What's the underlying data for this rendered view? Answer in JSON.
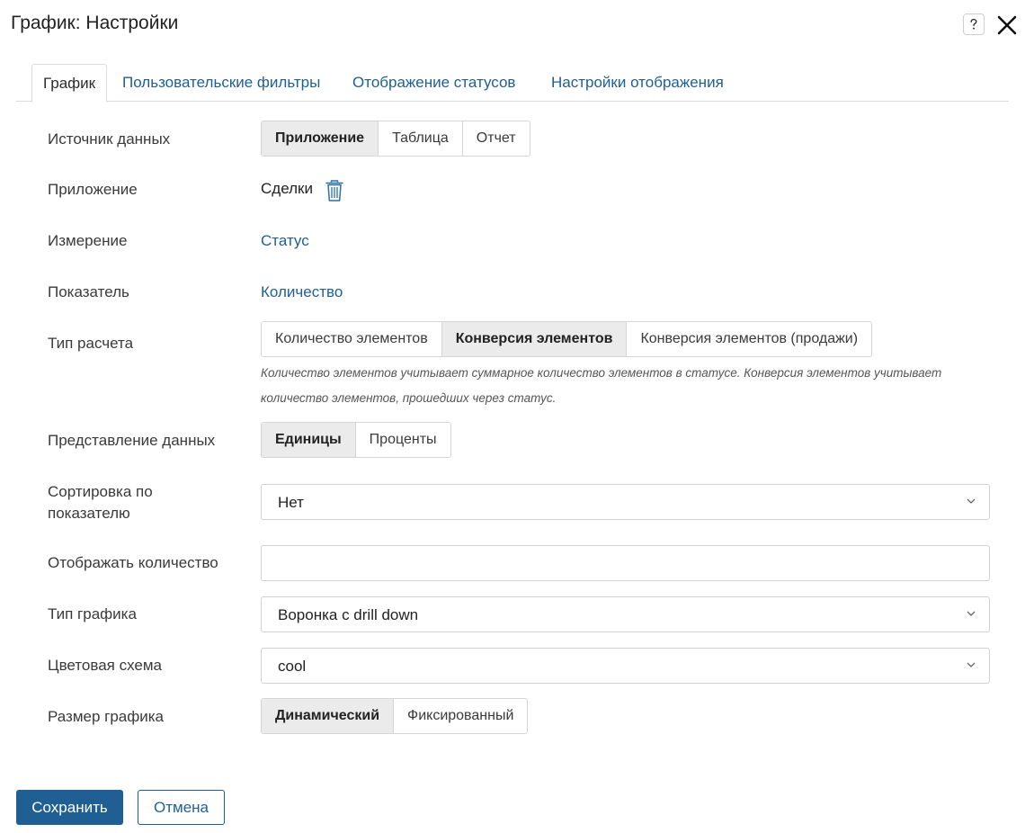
{
  "dialog": {
    "title": "График: Настройки",
    "help_icon": "question-icon",
    "close_icon": "close-icon"
  },
  "tabs": [
    {
      "label": "График",
      "active": true
    },
    {
      "label": "Пользовательские фильтры",
      "active": false
    },
    {
      "label": "Отображение статусов",
      "active": false
    },
    {
      "label": "Настройки отображения",
      "active": false
    }
  ],
  "form": {
    "data_source": {
      "label": "Источник данных",
      "options": [
        "Приложение",
        "Таблица",
        "Отчет"
      ],
      "selected": "Приложение"
    },
    "app": {
      "label": "Приложение",
      "value": "Сделки",
      "delete_icon": "trash-icon"
    },
    "dimension": {
      "label": "Измерение",
      "value": "Статус"
    },
    "metric": {
      "label": "Показатель",
      "value": "Количество"
    },
    "calc_type": {
      "label": "Тип расчета",
      "options": [
        "Количество элементов",
        "Конверсия элементов",
        "Конверсия элементов (продажи)"
      ],
      "selected": "Конверсия элементов",
      "hint": "Количество элементов учитывает суммарное количество элементов в статусе. Конверсия элементов учитывает количество элементов, прошедших через статус."
    },
    "data_view": {
      "label": "Представление данных",
      "options": [
        "Единицы",
        "Проценты"
      ],
      "selected": "Единицы"
    },
    "sort": {
      "label": "Сортировка по показателю",
      "value": "Нет"
    },
    "show_count": {
      "label": "Отображать количество",
      "value": ""
    },
    "chart_type": {
      "label": "Тип графика",
      "value": "Воронка с drill down"
    },
    "color_scheme": {
      "label": "Цветовая схема",
      "value": "cool"
    },
    "chart_size": {
      "label": "Размер графика",
      "options": [
        "Динамический",
        "Фиксированный"
      ],
      "selected": "Динамический"
    }
  },
  "footer": {
    "save_label": "Сохранить",
    "cancel_label": "Отмена"
  },
  "colors": {
    "accent": "#1f5f94",
    "segment_selected_bg": "#ebebeb",
    "border": "#d6d6d6"
  }
}
